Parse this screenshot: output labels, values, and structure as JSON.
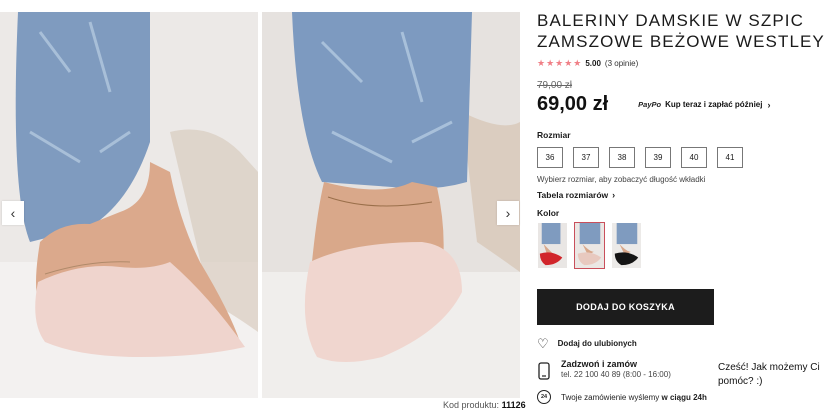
{
  "gallery": {
    "prev_icon": "chevron-left-icon",
    "next_icon": "chevron-right-icon",
    "prev_glyph": "‹",
    "next_glyph": "›",
    "sku_label": "Kod produktu:",
    "sku_value": "11126"
  },
  "product": {
    "title": "BALERINY DAMSKIE W SZPIC ZAMSZOWE BEŻOWE WESTLEY",
    "stars": "★★★★★",
    "rating_value": "5.00",
    "rating_count": "(3 opinie)",
    "old_price": "79,00 zł",
    "price": "69,00 zł",
    "paypo_logo": "PayPo",
    "paypo_text": "Kup teraz i zapłać później",
    "chevron": "›",
    "size_label": "Rozmiar",
    "sizes": [
      "36",
      "37",
      "38",
      "39",
      "40",
      "41"
    ],
    "size_hint": "Wybierz rozmiar, aby zobaczyć długość wkładki",
    "size_table_link": "Tabela rozmiarów",
    "color_label": "Kolor",
    "swatches": [
      {
        "name": "red",
        "color": "#d1252b"
      },
      {
        "name": "beige",
        "color": "#e8c9bf"
      },
      {
        "name": "black",
        "color": "#151515"
      }
    ],
    "add_to_cart": "DODAJ DO KOSZYKA",
    "favorite_icon": "heart-icon",
    "favorite_glyph": "♡",
    "favorite_label": "Dodaj do ulubionych",
    "phone_title": "Zadzwoń i zamów",
    "phone_sub": "tel. 22 100 40 89 (8:00 - 16:00)",
    "ship_badge": "24",
    "ship_text": "Twoje zamówienie wyślemy",
    "ship_bold": "w ciągu 24h"
  },
  "chat": {
    "message": "Cześć! Jak możemy Ci pomóc? :)"
  },
  "colors": {
    "button_bg": "#1c1c1c",
    "star": "#f07f86",
    "selected_swatch_border": "#c94f5b"
  }
}
